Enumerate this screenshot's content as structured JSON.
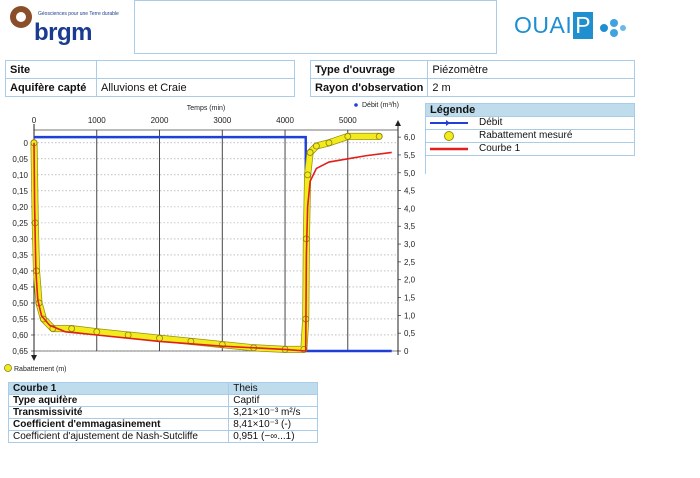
{
  "header": {
    "brgm_tagline": "Géosciences pour une Terre durable",
    "brgm_name": "brgm",
    "ouaip_text": "OUAI",
    "ouaip_box_letter": "P"
  },
  "site_table": {
    "site_label": "Site",
    "site_value": "",
    "aquifer_label": "Aquifère capté",
    "aquifer_value": "Alluvions et Craie"
  },
  "ouvrage_table": {
    "type_label": "Type d'ouvrage",
    "type_value": "Piézomètre",
    "rayon_label": "Rayon d'observation",
    "rayon_value": "2 m"
  },
  "legend": {
    "title": "Légende",
    "items": [
      {
        "label": "Débit",
        "symbol": "blue-line-icon"
      },
      {
        "label": "Rabattement mesuré",
        "symbol": "yellow-dot-icon"
      },
      {
        "label": "Courbe 1",
        "symbol": "red-line-icon"
      }
    ]
  },
  "chart_data": {
    "type": "line",
    "xlabel": "Temps (min)",
    "ylabel_left": "Rabattement (m)",
    "ylabel_right": "Débit (m³/h)",
    "xlim": [
      0,
      5800
    ],
    "ylim_left": [
      -0.04,
      0.65
    ],
    "ylim_right": [
      0,
      6.2
    ],
    "x_ticks": [
      0,
      1000,
      2000,
      3000,
      4000,
      5000
    ],
    "x_tick_labels": [
      "0",
      "1000",
      "2000",
      "3000",
      "4000",
      "5000"
    ],
    "y_left_ticks": [
      0,
      0.05,
      0.1,
      0.15,
      0.2,
      0.25,
      0.3,
      0.35,
      0.4,
      0.45,
      0.5,
      0.55,
      0.6,
      0.65
    ],
    "y_left_tick_labels": [
      "0",
      "0,05",
      "0,10",
      "0,15",
      "0,20",
      "0,25",
      "0,30",
      "0,35",
      "0,40",
      "0,45",
      "0,50",
      "0,55",
      "0,60",
      "0,65"
    ],
    "y_right_ticks": [
      0,
      0.5,
      1.0,
      1.5,
      2.0,
      2.5,
      3.0,
      3.5,
      4.0,
      4.5,
      5.0,
      5.5,
      6.0
    ],
    "y_right_tick_labels": [
      "0",
      "0,5",
      "1,0",
      "1,5",
      "2,0",
      "2,5",
      "3,0",
      "3,5",
      "4,0",
      "4,5",
      "5,0",
      "5,5",
      "6,0"
    ],
    "grid": true,
    "series": [
      {
        "name": "Débit",
        "axis": "right",
        "color": "#1f3fd6",
        "x": [
          0,
          4330,
          4330,
          5700
        ],
        "y": [
          6.0,
          6.0,
          0,
          0
        ]
      },
      {
        "name": "Rabattement mesuré",
        "axis": "left",
        "color": "#f2ec1c",
        "x": [
          0,
          20,
          40,
          80,
          150,
          300,
          600,
          1000,
          1500,
          2000,
          2500,
          3000,
          3500,
          4000,
          4300,
          4330,
          4340,
          4360,
          4400,
          4500,
          4700,
          5000,
          5500
        ],
        "y": [
          0,
          0.25,
          0.4,
          0.5,
          0.55,
          0.58,
          0.58,
          0.59,
          0.6,
          0.61,
          0.62,
          0.63,
          0.64,
          0.645,
          0.645,
          0.55,
          0.3,
          0.1,
          0.03,
          0.01,
          0.0,
          -0.02,
          -0.02
        ]
      },
      {
        "name": "Courbe 1",
        "axis": "left",
        "color": "#e0201c",
        "x": [
          0,
          10,
          30,
          60,
          120,
          250,
          500,
          1000,
          2000,
          3000,
          4000,
          4330,
          4331,
          4340,
          4360,
          4400,
          4500,
          4700,
          5000,
          5300,
          5700
        ],
        "y": [
          0,
          0.2,
          0.4,
          0.49,
          0.54,
          0.57,
          0.59,
          0.6,
          0.62,
          0.635,
          0.645,
          0.65,
          0.6,
          0.35,
          0.2,
          0.12,
          0.08,
          0.06,
          0.05,
          0.04,
          0.03
        ]
      }
    ]
  },
  "results": {
    "curve_label": "Courbe 1",
    "curve_method": "Theis",
    "rows": [
      {
        "label": "Type aquifère",
        "value": "Captif"
      },
      {
        "label": "Transmissivité",
        "value": "3,21×10⁻³ m²/s"
      },
      {
        "label": "Coefficient d'emmagasinement",
        "value": "8,41×10⁻³ (-)"
      },
      {
        "label": "Coefficient d'ajustement de Nash-Sutcliffe",
        "value": "0,951 (−∞...1)"
      }
    ]
  }
}
